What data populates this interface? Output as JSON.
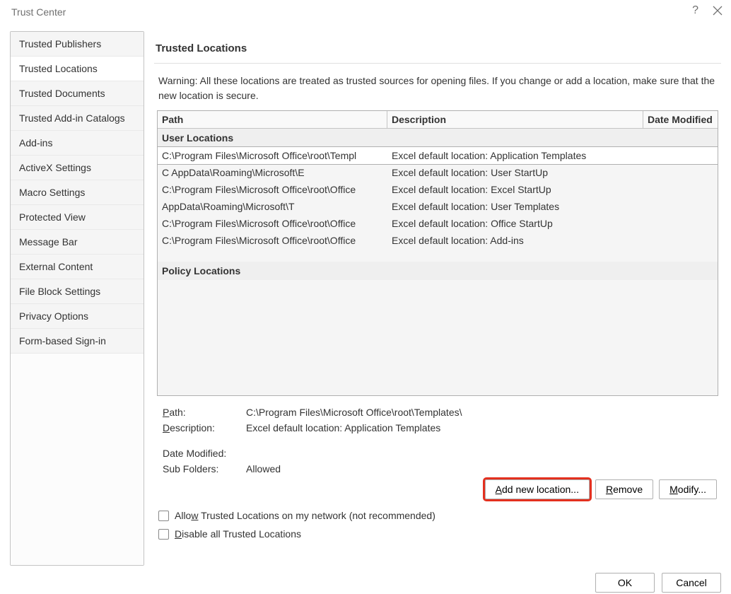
{
  "title": "Trust Center",
  "sidebar": {
    "items": [
      {
        "label": "Trusted Publishers"
      },
      {
        "label": "Trusted Locations",
        "selected": true
      },
      {
        "label": "Trusted Documents"
      },
      {
        "label": "Trusted Add-in Catalogs"
      },
      {
        "label": "Add-ins"
      },
      {
        "label": "ActiveX Settings"
      },
      {
        "label": "Macro Settings"
      },
      {
        "label": "Protected View"
      },
      {
        "label": "Message Bar"
      },
      {
        "label": "External Content"
      },
      {
        "label": "File Block Settings"
      },
      {
        "label": "Privacy Options"
      },
      {
        "label": "Form-based Sign-in"
      }
    ]
  },
  "main": {
    "heading": "Trusted Locations",
    "warning": "Warning: All these locations are treated as trusted sources for opening files.  If you change or add a location, make sure that the new location is secure.",
    "columns": {
      "path": "Path",
      "description": "Description",
      "date": "Date Modified"
    },
    "groups": {
      "user": "User Locations",
      "policy": "Policy Locations"
    },
    "rows": [
      {
        "path": "C:\\Program Files\\Microsoft Office\\root\\Templ",
        "desc": "Excel default location: Application Templates",
        "selected": true
      },
      {
        "path": "C              AppData\\Roaming\\Microsoft\\E",
        "desc": "Excel default location: User StartUp"
      },
      {
        "path": "C:\\Program Files\\Microsoft Office\\root\\Office",
        "desc": "Excel default location: Excel StartUp"
      },
      {
        "path": "                  AppData\\Roaming\\Microsoft\\T",
        "desc": "Excel default location: User Templates"
      },
      {
        "path": "C:\\Program Files\\Microsoft Office\\root\\Office",
        "desc": "Excel default location: Office StartUp"
      },
      {
        "path": "C:\\Program Files\\Microsoft Office\\root\\Office",
        "desc": "Excel default location: Add-ins"
      }
    ],
    "details": {
      "path_label": "Path:",
      "path_value": "C:\\Program Files\\Microsoft Office\\root\\Templates\\",
      "desc_label": "Description:",
      "desc_value": "Excel default location: Application Templates",
      "date_label": "Date Modified:",
      "date_value": "",
      "sub_label": "Sub Folders:",
      "sub_value": "Allowed"
    },
    "buttons": {
      "add": "Add new location...",
      "remove": "Remove",
      "modify": "Modify..."
    },
    "checkboxes": {
      "allow_network": "Allow Trusted Locations on my network (not recommended)",
      "disable_all": "Disable all Trusted Locations"
    }
  },
  "footer": {
    "ok": "OK",
    "cancel": "Cancel"
  }
}
